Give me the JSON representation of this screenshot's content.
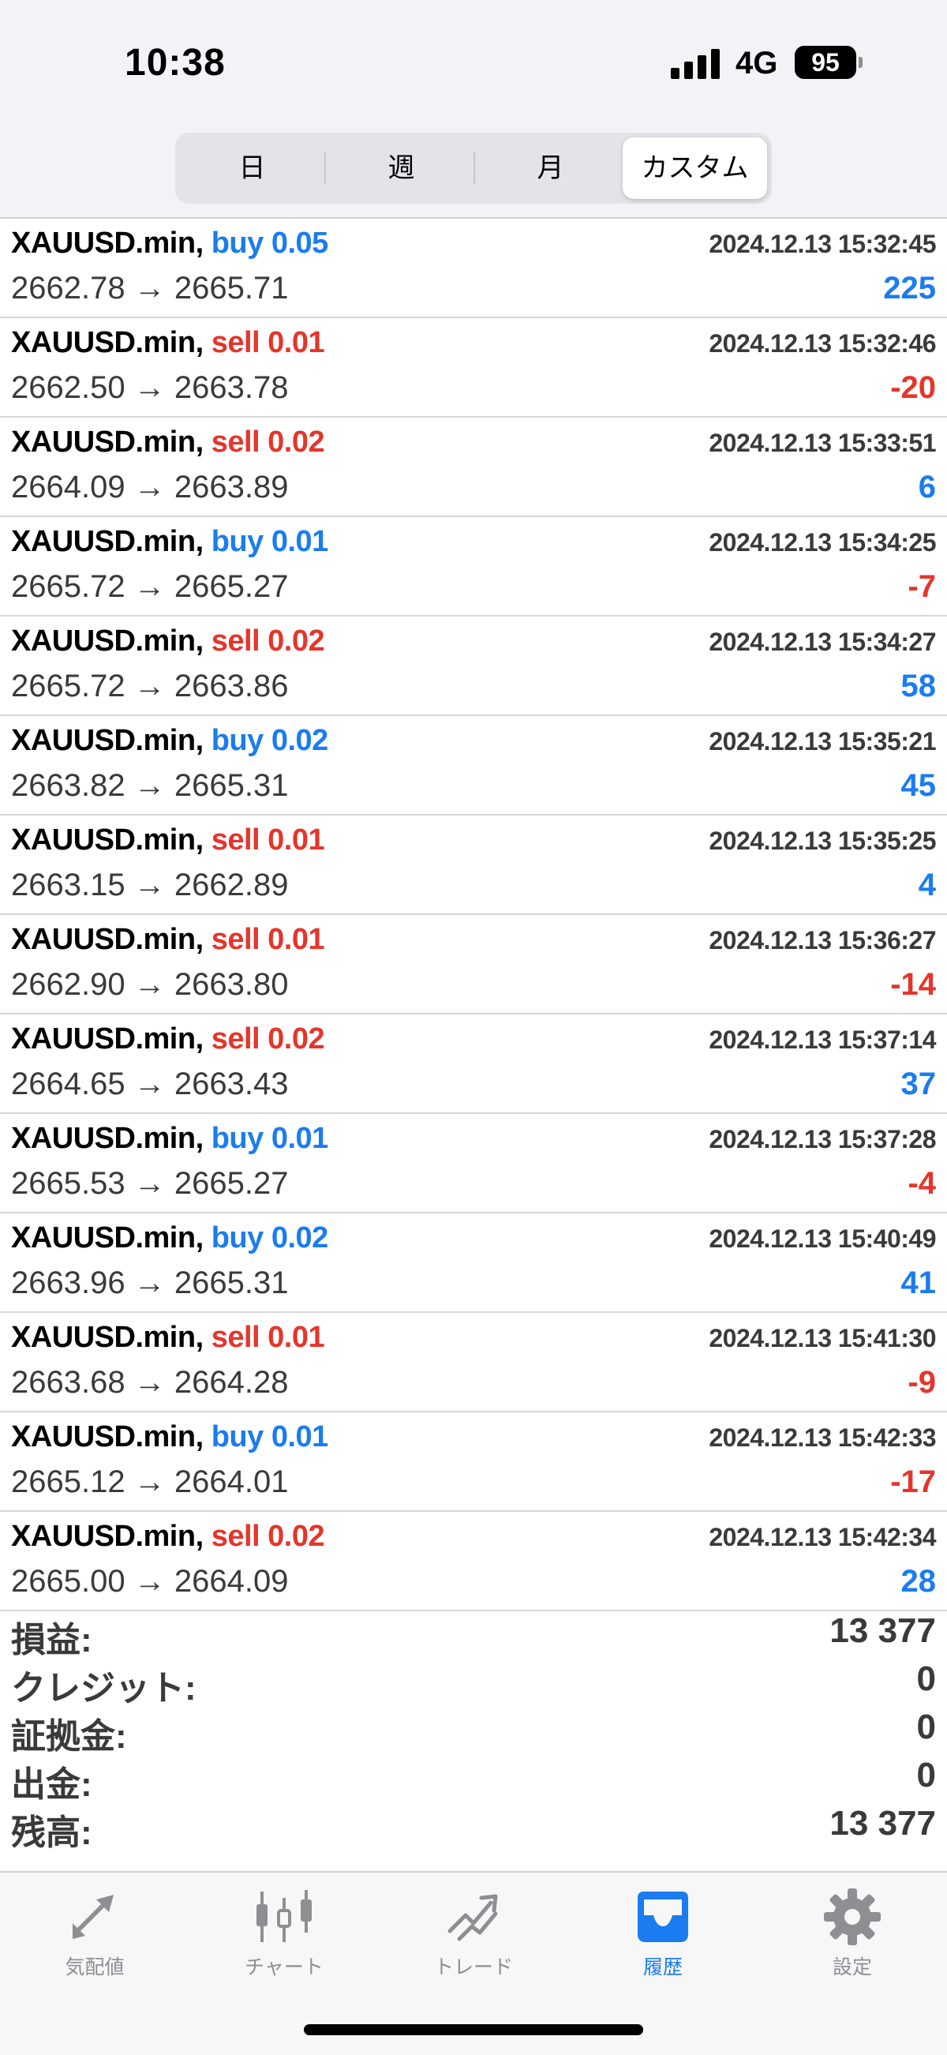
{
  "status_bar": {
    "time": "10:38",
    "network": "4G",
    "battery": "95"
  },
  "segments": [
    {
      "label": "日",
      "active": false
    },
    {
      "label": "週",
      "active": false
    },
    {
      "label": "月",
      "active": false
    },
    {
      "label": "カスタム",
      "active": true
    }
  ],
  "arrow": "→",
  "trades": [
    {
      "symbol": "XAUUSD.min,",
      "side": "buy",
      "volume": "0.05",
      "datetime": "2024.12.13 15:32:45",
      "open": "2662.78",
      "close": "2665.71",
      "profit": "225"
    },
    {
      "symbol": "XAUUSD.min,",
      "side": "sell",
      "volume": "0.01",
      "datetime": "2024.12.13 15:32:46",
      "open": "2662.50",
      "close": "2663.78",
      "profit": "-20"
    },
    {
      "symbol": "XAUUSD.min,",
      "side": "sell",
      "volume": "0.02",
      "datetime": "2024.12.13 15:33:51",
      "open": "2664.09",
      "close": "2663.89",
      "profit": "6"
    },
    {
      "symbol": "XAUUSD.min,",
      "side": "buy",
      "volume": "0.01",
      "datetime": "2024.12.13 15:34:25",
      "open": "2665.72",
      "close": "2665.27",
      "profit": "-7"
    },
    {
      "symbol": "XAUUSD.min,",
      "side": "sell",
      "volume": "0.02",
      "datetime": "2024.12.13 15:34:27",
      "open": "2665.72",
      "close": "2663.86",
      "profit": "58"
    },
    {
      "symbol": "XAUUSD.min,",
      "side": "buy",
      "volume": "0.02",
      "datetime": "2024.12.13 15:35:21",
      "open": "2663.82",
      "close": "2665.31",
      "profit": "45"
    },
    {
      "symbol": "XAUUSD.min,",
      "side": "sell",
      "volume": "0.01",
      "datetime": "2024.12.13 15:35:25",
      "open": "2663.15",
      "close": "2662.89",
      "profit": "4"
    },
    {
      "symbol": "XAUUSD.min,",
      "side": "sell",
      "volume": "0.01",
      "datetime": "2024.12.13 15:36:27",
      "open": "2662.90",
      "close": "2663.80",
      "profit": "-14"
    },
    {
      "symbol": "XAUUSD.min,",
      "side": "sell",
      "volume": "0.02",
      "datetime": "2024.12.13 15:37:14",
      "open": "2664.65",
      "close": "2663.43",
      "profit": "37"
    },
    {
      "symbol": "XAUUSD.min,",
      "side": "buy",
      "volume": "0.01",
      "datetime": "2024.12.13 15:37:28",
      "open": "2665.53",
      "close": "2665.27",
      "profit": "-4"
    },
    {
      "symbol": "XAUUSD.min,",
      "side": "buy",
      "volume": "0.02",
      "datetime": "2024.12.13 15:40:49",
      "open": "2663.96",
      "close": "2665.31",
      "profit": "41"
    },
    {
      "symbol": "XAUUSD.min,",
      "side": "sell",
      "volume": "0.01",
      "datetime": "2024.12.13 15:41:30",
      "open": "2663.68",
      "close": "2664.28",
      "profit": "-9"
    },
    {
      "symbol": "XAUUSD.min,",
      "side": "buy",
      "volume": "0.01",
      "datetime": "2024.12.13 15:42:33",
      "open": "2665.12",
      "close": "2664.01",
      "profit": "-17"
    },
    {
      "symbol": "XAUUSD.min,",
      "side": "sell",
      "volume": "0.02",
      "datetime": "2024.12.13 15:42:34",
      "open": "2665.00",
      "close": "2664.09",
      "profit": "28"
    }
  ],
  "summary": [
    {
      "label": "損益:",
      "value": "13 377"
    },
    {
      "label": "クレジット:",
      "value": "0"
    },
    {
      "label": "証拠金:",
      "value": "0"
    },
    {
      "label": "出金:",
      "value": "0"
    },
    {
      "label": "残高:",
      "value": "13 377"
    }
  ],
  "tabs": [
    {
      "label": "気配値",
      "icon": "quotes-arrows-icon",
      "active": false
    },
    {
      "label": "チャート",
      "icon": "candlestick-chart-icon",
      "active": false
    },
    {
      "label": "トレード",
      "icon": "trade-trend-icon",
      "active": false
    },
    {
      "label": "履歴",
      "icon": "history-inbox-icon",
      "active": true
    },
    {
      "label": "設定",
      "icon": "gear-icon",
      "active": false
    }
  ],
  "colors": {
    "buy": "#1a7cf0",
    "sell": "#e5352b",
    "active_tab": "#1a7cf0",
    "inactive_tab": "#8e8e93"
  }
}
